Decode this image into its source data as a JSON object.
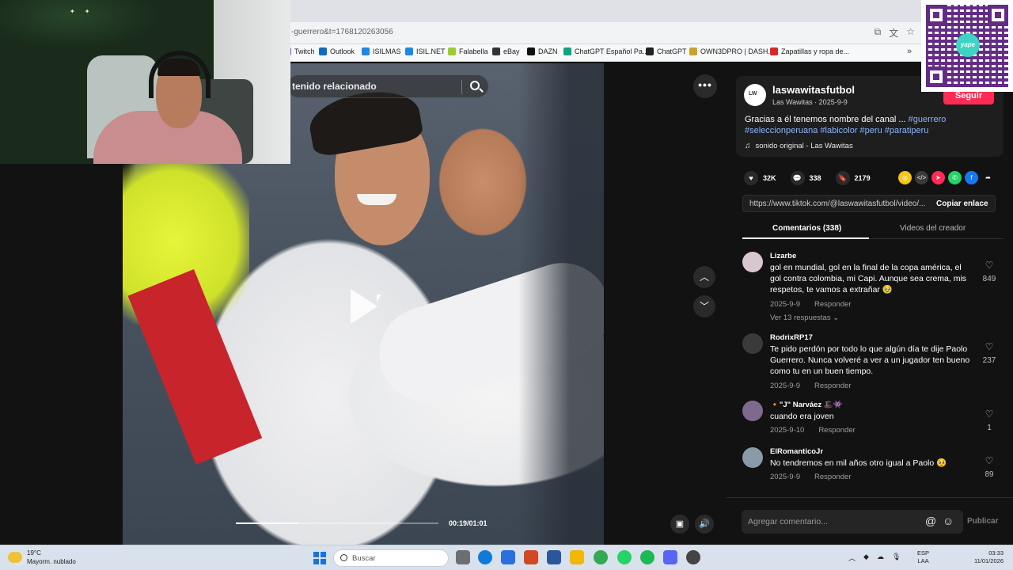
{
  "browser": {
    "url": "-guerrero&t=1768120263056",
    "bookmarks": [
      {
        "label": "Twitch",
        "color": "#9146ff"
      },
      {
        "label": "Outlook",
        "color": "#0f6cbd"
      },
      {
        "label": "ISILMAS",
        "color": "#1e88e5"
      },
      {
        "label": "ISIL.NET",
        "color": "#1e88e5"
      },
      {
        "label": "Falabella",
        "color": "#9acd32"
      },
      {
        "label": "eBay",
        "color": "#333333"
      },
      {
        "label": "DAZN",
        "color": "#111111"
      },
      {
        "label": "ChatGPT Español Pa...",
        "color": "#10a37f"
      },
      {
        "label": "ChatGPT",
        "color": "#222222"
      },
      {
        "label": "OWN3DPRO | DASH...",
        "color": "#c9a227"
      },
      {
        "label": "Zapatillas y ropa de...",
        "color": "#d62828"
      }
    ],
    "more_label": "»"
  },
  "video": {
    "search_text": "tenido relacionado",
    "more_label": "•••",
    "up_label": "︿",
    "down_label": "﹀",
    "time": "00:19/01:01",
    "progress": 0.31
  },
  "post": {
    "author": "laswawitasfutbol",
    "author_sub": "Las Wawitas · 2025-9-9",
    "follow_label": "Seguir",
    "caption_text": "Gracias a él tenemos nombre del canal ... ",
    "hashtags": [
      "#guerrero",
      "#seleccionperuana",
      "#labicolor",
      "#peru",
      "#paratiperu"
    ],
    "sound": "sonido original - Las Wawitas",
    "likes": "32K",
    "comments_count": "338",
    "saves": "2179",
    "link": "https://www.tiktok.com/@laswawitasfutbol/video/...",
    "copy_label": "Copiar enlace"
  },
  "tabs": {
    "comments": "Comentarios (338)",
    "creator_videos": "Videos del creador"
  },
  "comments": [
    {
      "user": "Lizarbe",
      "text": "gol en mundial, gol en la final de la copa américa, el gol contra colombia, mi Capi. Aunque sea crema, mis respetos, te vamos a extrañar 🥹",
      "date": "2025-9-9",
      "reply": "Responder",
      "likes": "849",
      "replies": "Ver 13 respuestas ⌄",
      "avatar_color": "#d9c7cf"
    },
    {
      "user": "RodrixRP17",
      "text": "Te pido perdón por todo lo que algún día te dije Paolo Guerrero. Nunca volveré a ver a un jugador ten bueno como tu en un buen tiempo.",
      "date": "2025-9-9",
      "reply": "Responder",
      "likes": "237",
      "avatar_color": "#3a3a3a"
    },
    {
      "user": "🔸\"J\" Narváez 🎩👾",
      "text": "cuando era joven",
      "date": "2025-9-10",
      "reply": "Responder",
      "likes": "1",
      "avatar_color": "#7d6a8c"
    },
    {
      "user": "ElRomanticoJr",
      "text": "No tendremos en mil años otro igual a Paolo 🥹",
      "date": "2025-9-9",
      "reply": "Responder",
      "likes": "89",
      "avatar_color": "#8a9aa8"
    }
  ],
  "comment_bar": {
    "placeholder": "Agregar comentario...",
    "publish": "Publicar"
  },
  "qr": {
    "logo_text": "yape"
  },
  "taskbar": {
    "temp": "19°C",
    "weather": "Mayorm. nublado",
    "search": "Buscar",
    "lang_top": "ESP",
    "lang_bottom": "LAA",
    "time": "03:33",
    "date": "11/01/2026"
  }
}
